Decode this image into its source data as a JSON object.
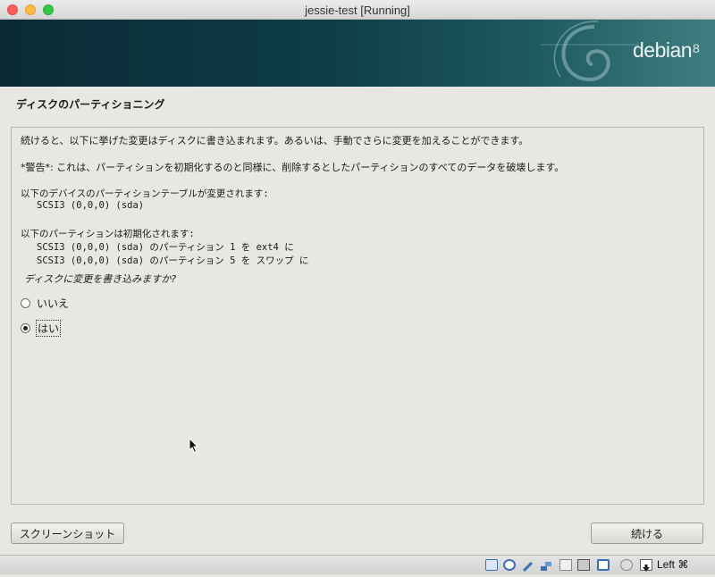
{
  "window": {
    "title": "jessie-test [Running]"
  },
  "banner": {
    "brand": "debian",
    "version": "8"
  },
  "page": {
    "heading": "ディスクのパーティショニング"
  },
  "content": {
    "intro": "続けると、以下に挙げた変更はディスクに書き込まれます。あるいは、手動でさらに変更を加えることができます。",
    "warning": "*警告*: これは、パーティションを初期化するのと同様に、削除するとしたパーティションのすべてのデータを破壊します。",
    "tables_heading": "以下のデバイスのパーティションテーブルが変更されます:",
    "tables": [
      "SCSI3 (0,0,0) (sda)"
    ],
    "partitions_heading": "以下のパーティションは初期化されます:",
    "partitions": [
      "SCSI3 (0,0,0) (sda) のパーティション 1 を ext4 に",
      "SCSI3 (0,0,0) (sda) のパーティション 5 を スワップ に"
    ],
    "question": "ディスクに変更を書き込みますか?",
    "options": [
      {
        "label": "いいえ",
        "selected": false
      },
      {
        "label": "はい",
        "selected": true
      }
    ]
  },
  "buttons": {
    "screenshot": "スクリーンショット",
    "continue": "続ける"
  },
  "statusbar": {
    "icons": [
      "hard-disk-icon",
      "optical-drive-icon",
      "usb-icon",
      "network-icon",
      "shared-folder-icon",
      "display-icon",
      "video-capture-icon",
      "mouse-integration-icon",
      "host-key-arrow-icon"
    ],
    "host_key": "Left ⌘"
  }
}
